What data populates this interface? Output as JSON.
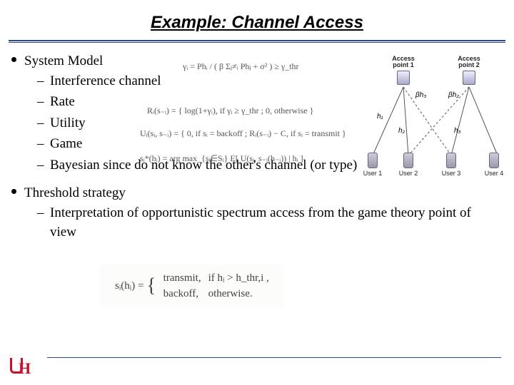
{
  "title": "Example: Channel Access",
  "bullets": {
    "b1": "System Model",
    "b1_sub": {
      "s1": "Interference channel",
      "s2": "Rate",
      "s3": "Utility",
      "s4": "Game",
      "s5": "Bayesian since do not know the other's channel (or type)"
    },
    "b2": "Threshold strategy",
    "b2_sub": {
      "s1": "Interpretation of opportunistic spectrum access from the game theory point of view"
    }
  },
  "equations": {
    "sinr": "γᵢ = Phᵢ / ( β Σⱼ≠ᵢ Phⱼ + σ² )  ≥ γ_thr",
    "rate": "Rᵢ(s₋ᵢ) = { log(1+γᵢ), if γᵢ ≥ γ_thr ;  0, otherwise }",
    "utility": "Uᵢ(sᵢ, s₋ᵢ) = { 0, if sᵢ = backoff ;  Rᵢ(s₋ᵢ) − C, if sᵢ = transmit }",
    "game": "sᵢ*(hᵢ) = arg max_{sᵢ∈Sᵢ} E[ U(sᵢ, s₋ᵢ(h₋ᵢ)) | hᵢ ]",
    "strategy_lhs": "sᵢ(hᵢ) =",
    "strategy_r1a": "transmit,",
    "strategy_r1b": "if hᵢ > h_thr,i ,",
    "strategy_r2a": "backoff,",
    "strategy_r2b": "otherwise."
  },
  "diagram": {
    "ap1": "Access\npoint 1",
    "ap2": "Access\npoint 2",
    "u1": "User 1",
    "u2": "User 2",
    "u3": "User 3",
    "u4": "User 4",
    "h1": "h₁",
    "h2": "h₂",
    "h3": "h₃",
    "bh2": "βh₂",
    "bh3": "βh₃"
  }
}
